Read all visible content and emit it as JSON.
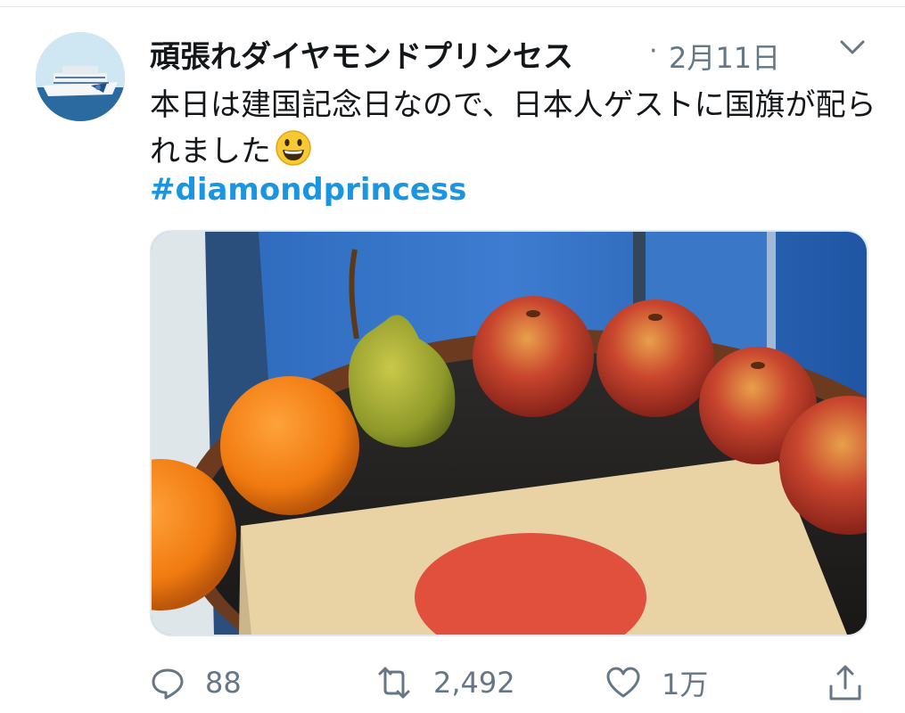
{
  "tweet": {
    "author_name": "頑張れダイヤモンドプリンセス",
    "separator": "·",
    "date": "2月11日",
    "text": "本日は建国記念日なので、日本人ゲストに国旗が配られました",
    "emoji": "grinning-face-emoji",
    "hashtag": "#diamondprincess"
  },
  "actions": {
    "reply_count": "88",
    "retweet_count": "2,492",
    "like_count": "1万"
  },
  "icons": {
    "avatar": "cruise-ship-avatar",
    "menu": "chevron-down-icon",
    "reply": "reply-icon",
    "retweet": "retweet-icon",
    "like": "heart-icon",
    "share": "share-icon"
  },
  "colors": {
    "text": "#14171a",
    "muted": "#657786",
    "link": "#1b95e0",
    "border": "#e1e8ed"
  }
}
